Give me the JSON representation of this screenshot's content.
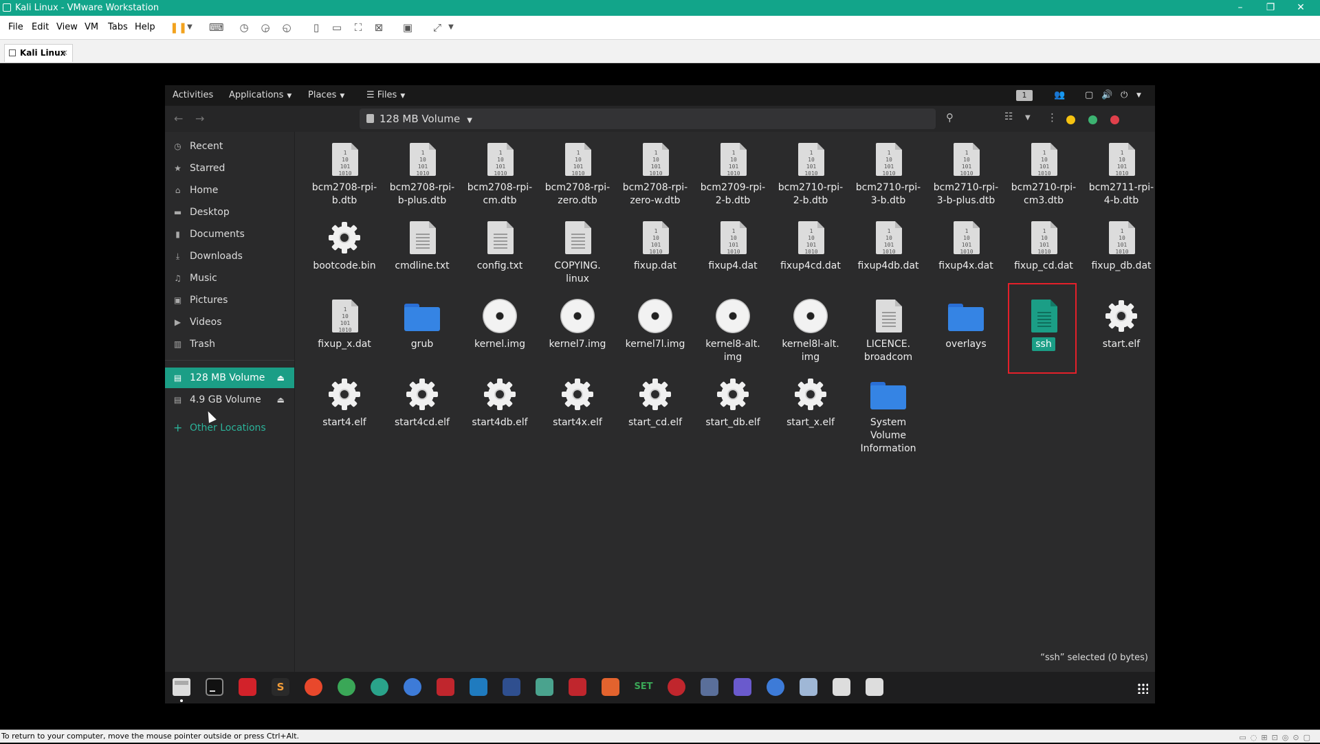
{
  "vmware": {
    "window_title": "Kali Linux - VMware Workstation",
    "menu": [
      "File",
      "Edit",
      "View",
      "VM",
      "Tabs",
      "Help"
    ],
    "tab_label": "Kali Linux",
    "status_text": "To return to your computer, move the mouse pointer outside or press Ctrl+Alt."
  },
  "topbar": {
    "activities": "Activities",
    "applications": "Applications",
    "places": "Places",
    "files": "Files",
    "workspace": "1"
  },
  "header": {
    "location": "128 MB Volume"
  },
  "sidebar": {
    "items": [
      {
        "label": "Recent",
        "icon": "clock-icon"
      },
      {
        "label": "Starred",
        "icon": "star-icon"
      },
      {
        "label": "Home",
        "icon": "home-icon"
      },
      {
        "label": "Desktop",
        "icon": "desktop-icon"
      },
      {
        "label": "Documents",
        "icon": "document-icon"
      },
      {
        "label": "Downloads",
        "icon": "download-icon"
      },
      {
        "label": "Music",
        "icon": "music-icon"
      },
      {
        "label": "Pictures",
        "icon": "picture-icon"
      },
      {
        "label": "Videos",
        "icon": "video-icon"
      },
      {
        "label": "Trash",
        "icon": "trash-icon"
      }
    ],
    "volumes": [
      {
        "label": "128 MB Volume",
        "active": true
      },
      {
        "label": "4.9 GB Volume",
        "active": false
      }
    ],
    "other_locations": "Other Locations"
  },
  "files": [
    {
      "name": "bcm2708-rpi-\nb.dtb",
      "type": "binary"
    },
    {
      "name": "bcm2708-rpi-\nb-plus.dtb",
      "type": "binary"
    },
    {
      "name": "bcm2708-rpi-\ncm.dtb",
      "type": "binary"
    },
    {
      "name": "bcm2708-rpi-\nzero.dtb",
      "type": "binary"
    },
    {
      "name": "bcm2708-rpi-\nzero-w.dtb",
      "type": "binary"
    },
    {
      "name": "bcm2709-rpi-\n2-b.dtb",
      "type": "binary"
    },
    {
      "name": "bcm2710-rpi-\n2-b.dtb",
      "type": "binary"
    },
    {
      "name": "bcm2710-rpi-\n3-b.dtb",
      "type": "binary"
    },
    {
      "name": "bcm2710-rpi-\n3-b-plus.dtb",
      "type": "binary"
    },
    {
      "name": "bcm2710-rpi-\ncm3.dtb",
      "type": "binary"
    },
    {
      "name": "bcm2711-rpi-\n4-b.dtb",
      "type": "binary"
    },
    {
      "name": "bootcode.bin",
      "type": "executable"
    },
    {
      "name": "cmdline.txt",
      "type": "text"
    },
    {
      "name": "config.txt",
      "type": "text"
    },
    {
      "name": "COPYING.\nlinux",
      "type": "text"
    },
    {
      "name": "fixup.dat",
      "type": "binary"
    },
    {
      "name": "fixup4.dat",
      "type": "binary"
    },
    {
      "name": "fixup4cd.dat",
      "type": "binary"
    },
    {
      "name": "fixup4db.dat",
      "type": "binary"
    },
    {
      "name": "fixup4x.dat",
      "type": "binary"
    },
    {
      "name": "fixup_cd.dat",
      "type": "binary"
    },
    {
      "name": "fixup_db.dat",
      "type": "binary"
    },
    {
      "name": "fixup_x.dat",
      "type": "binary"
    },
    {
      "name": "grub",
      "type": "folder"
    },
    {
      "name": "kernel.img",
      "type": "disc"
    },
    {
      "name": "kernel7.img",
      "type": "disc"
    },
    {
      "name": "kernel7l.img",
      "type": "disc"
    },
    {
      "name": "kernel8-alt.\nimg",
      "type": "disc"
    },
    {
      "name": "kernel8l-alt.\nimg",
      "type": "disc"
    },
    {
      "name": "LICENCE.\nbroadcom",
      "type": "text"
    },
    {
      "name": "overlays",
      "type": "folder"
    },
    {
      "name": "ssh",
      "type": "text-green",
      "selected": true
    },
    {
      "name": "start.elf",
      "type": "executable"
    },
    {
      "name": "start4.elf",
      "type": "executable"
    },
    {
      "name": "start4cd.elf",
      "type": "executable"
    },
    {
      "name": "start4db.elf",
      "type": "executable"
    },
    {
      "name": "start4x.elf",
      "type": "executable"
    },
    {
      "name": "start_cd.elf",
      "type": "executable"
    },
    {
      "name": "start_db.elf",
      "type": "executable"
    },
    {
      "name": "start_x.elf",
      "type": "executable"
    },
    {
      "name": "System\nVolume\nInformation",
      "type": "folder"
    }
  ],
  "status": {
    "selection": "“ssh” selected  (0 bytes)"
  },
  "dock": [
    {
      "name": "files-app",
      "color": "#dddddd"
    },
    {
      "name": "terminal-app",
      "color": "#111111"
    },
    {
      "name": "red-app",
      "color": "#d2222a"
    },
    {
      "name": "sublime-app",
      "color": "#2a2a2a"
    },
    {
      "name": "firefox-app",
      "color": "#e8482c"
    },
    {
      "name": "chrome-app",
      "color": "#3aa757"
    },
    {
      "name": "maltego-app",
      "color": "#2aa38a"
    },
    {
      "name": "eye-app",
      "color": "#3d7bd8"
    },
    {
      "name": "zap-app",
      "color": "#c0262d"
    },
    {
      "name": "wireshark-app",
      "color": "#1f7bbf"
    },
    {
      "name": "metasploit-app",
      "color": "#2f4f8f"
    },
    {
      "name": "owasp-app",
      "color": "#4aa38e"
    },
    {
      "name": "red-hat-app",
      "color": "#c0262d"
    },
    {
      "name": "burp-app",
      "color": "#e3632e"
    },
    {
      "name": "set-app",
      "color": "#3aa757"
    },
    {
      "name": "wifi-app",
      "color": "#c0262d"
    },
    {
      "name": "x-app",
      "color": "#5a6f9a"
    },
    {
      "name": "monitor-app",
      "color": "#6a5acd"
    },
    {
      "name": "settings-app",
      "color": "#3d7bd8"
    },
    {
      "name": "tweaks-app",
      "color": "#9fb7d6"
    },
    {
      "name": "usb-app",
      "color": "#dddddd"
    },
    {
      "name": "usb2-app",
      "color": "#dddddd"
    }
  ],
  "dock_labels": {
    "sublime": "S",
    "set": "SET"
  },
  "colors": {
    "accent": "#1b9e86",
    "selection_box": "#e5202a",
    "folder": "#3584e4"
  }
}
